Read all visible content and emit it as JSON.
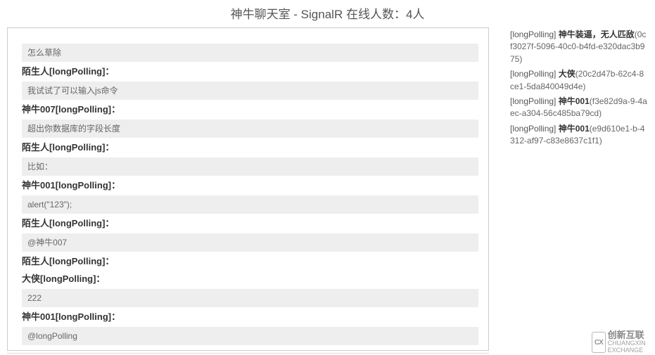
{
  "header": {
    "title": "神牛聊天室 - SignalR 在线人数：4人"
  },
  "messages": [
    {
      "content": "怎么草除",
      "author": "陌生人[longPolling]："
    },
    {
      "content": "我试试了可以输入js命令",
      "author": "神牛007[longPolling]："
    },
    {
      "content": "超出你数据库的字段长度",
      "author": "陌生人[longPolling]："
    },
    {
      "content": "比如：",
      "author": "神牛001[longPolling]："
    },
    {
      "content": "alert(\"123\");",
      "author": "陌生人[longPolling]："
    },
    {
      "content": "@神牛007",
      "author": "陌生人[longPolling]："
    },
    {
      "content": "",
      "author": "大侠[longPolling]：",
      "noContent": true
    },
    {
      "content": "222",
      "author": "神牛001[longPolling]："
    },
    {
      "content": "@longPolling",
      "author": ""
    }
  ],
  "users": [
    {
      "transport": "[longPolling]",
      "name": "神牛装逼，无人匹敌",
      "id": "(0cf3027f-5096-40c0-b4fd-e320dac3b975)"
    },
    {
      "transport": "[longPolling]",
      "name": "大侠",
      "id": "(20c2d47b-62c4-8ce1-5da840049d4e)"
    },
    {
      "transport": "[longPolling]",
      "name": "神牛001",
      "id": "(f3e82d9a-9-4aec-a304-56c485ba79cd)"
    },
    {
      "transport": "[longPolling]",
      "name": "神牛001",
      "id": "(e9d610e1-b-4312-af97-c83e8637c1f1)"
    }
  ],
  "watermark": {
    "icon": "CX",
    "cn": "创新互联",
    "en": "CHUANGXIN EXCHANGE"
  }
}
